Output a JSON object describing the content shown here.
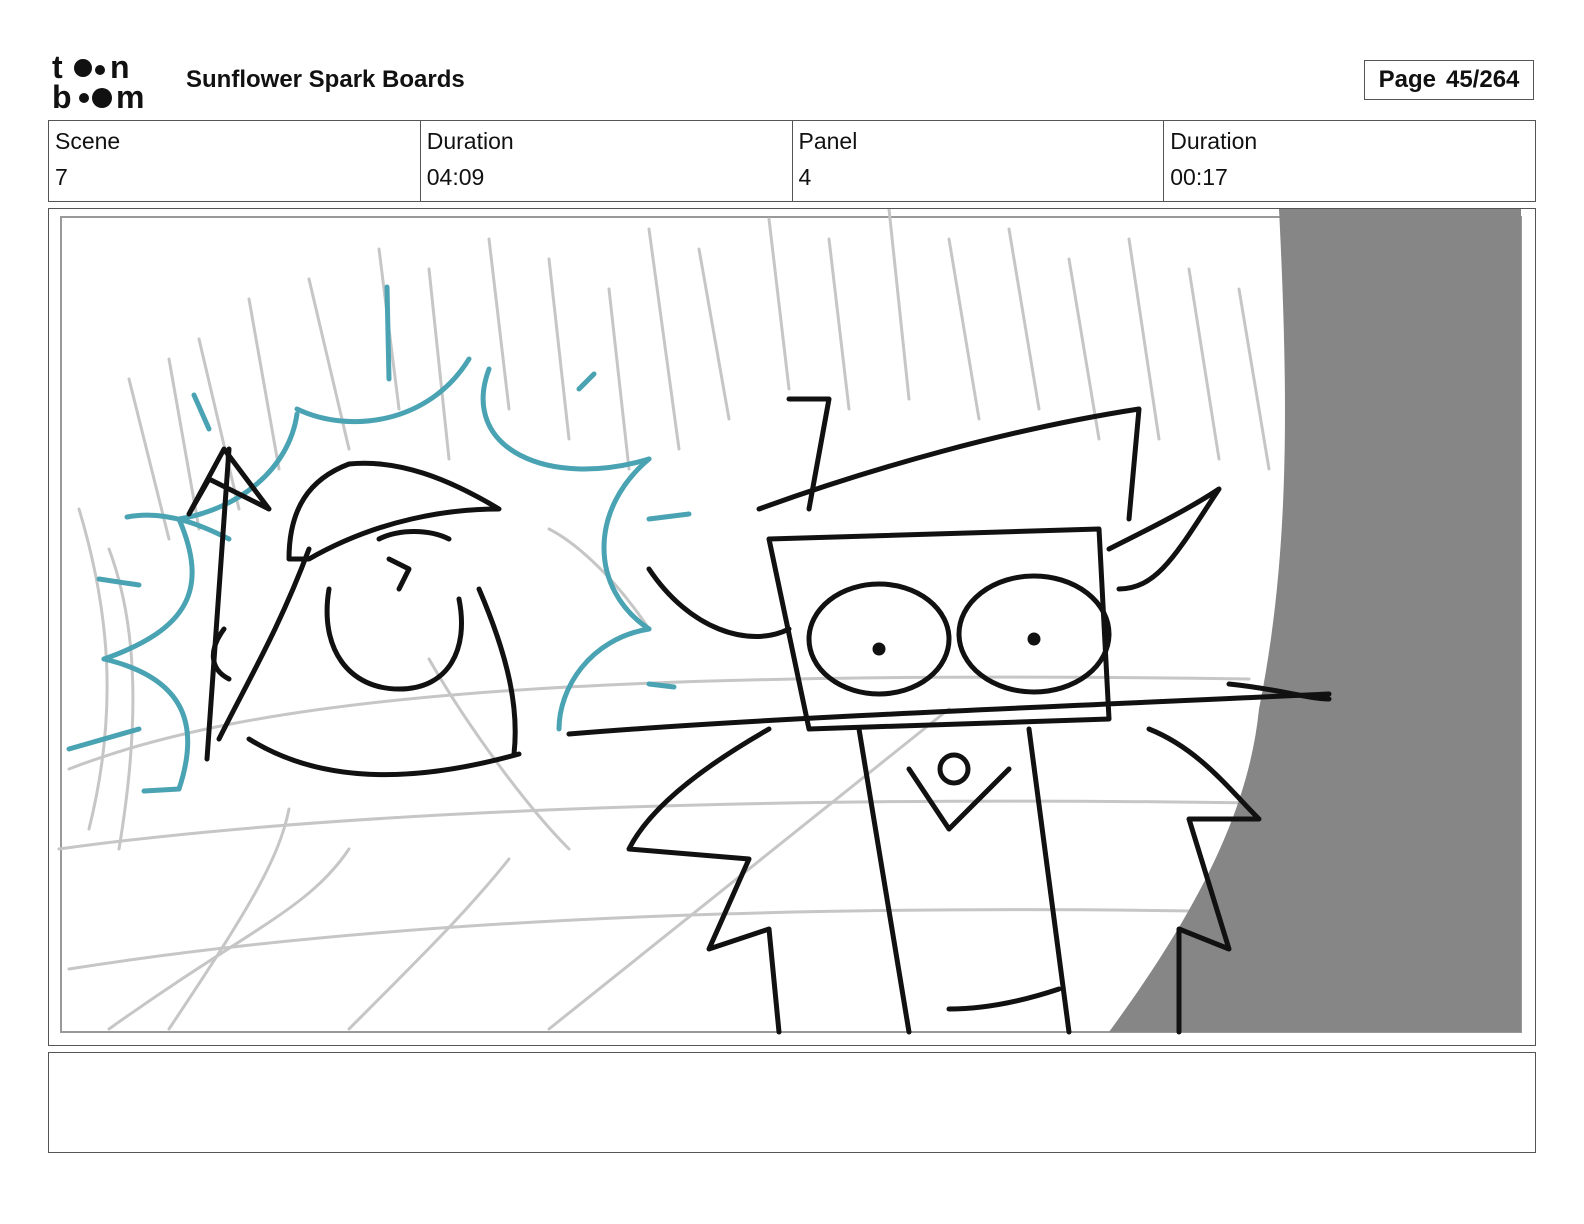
{
  "header": {
    "logo_text": "toonboom",
    "project_title": "Sunflower Spark Boards",
    "page_label": "Page",
    "page_value": "45/264"
  },
  "info": {
    "scene_label": "Scene",
    "scene_value": "7",
    "scene_duration_label": "Duration",
    "scene_duration_value": "04:09",
    "panel_label": "Panel",
    "panel_value": "4",
    "panel_duration_label": "Duration",
    "panel_duration_value": "00:17"
  },
  "panel_image": {
    "description_icon": "storyboard-sketch-icon"
  },
  "notes": {
    "text": ""
  },
  "colors": {
    "sketch_black": "#111111",
    "sketch_grey": "#c6c6c6",
    "sketch_teal": "#4aa3b3",
    "shadow_grey": "#868686"
  }
}
